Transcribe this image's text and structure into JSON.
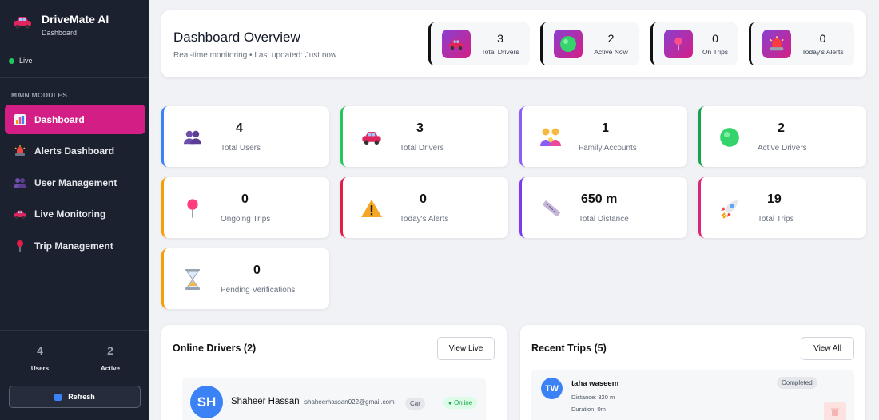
{
  "app": {
    "title": "DriveMate AI",
    "subtitle": "Dashboard",
    "status": "Live"
  },
  "sidebar": {
    "section_label": "MAIN MODULES",
    "items": [
      {
        "label": "Dashboard",
        "icon": "bar-chart-icon",
        "active": true
      },
      {
        "label": "Alerts Dashboard",
        "icon": "siren-icon"
      },
      {
        "label": "User Management",
        "icon": "users-icon"
      },
      {
        "label": "Live Monitoring",
        "icon": "car-icon"
      },
      {
        "label": "Trip Management",
        "icon": "pin-icon"
      }
    ],
    "stats": [
      {
        "value": "4",
        "label": "Users"
      },
      {
        "value": "2",
        "label": "Active"
      }
    ],
    "refresh_label": "Refresh"
  },
  "header": {
    "title": "Dashboard Overview",
    "subtitle": "Real-time monitoring • Last updated: Just now",
    "pills": [
      {
        "value": "3",
        "label": "Total Drivers",
        "icon": "car-icon"
      },
      {
        "value": "2",
        "label": "Active Now",
        "icon": "green-circle-icon"
      },
      {
        "value": "0",
        "label": "On Trips",
        "icon": "pin-icon"
      },
      {
        "value": "0",
        "label": "Today's Alerts",
        "icon": "siren-icon"
      }
    ]
  },
  "cards": [
    {
      "value": "4",
      "label": "Total Users",
      "icon": "users-icon",
      "accent": "#3b82f6"
    },
    {
      "value": "3",
      "label": "Total Drivers",
      "icon": "car-icon",
      "accent": "#22c55e"
    },
    {
      "value": "1",
      "label": "Family Accounts",
      "icon": "family-icon",
      "accent": "#8b5cf6"
    },
    {
      "value": "2",
      "label": "Active Drivers",
      "icon": "green-circle-icon",
      "accent": "#16a34a"
    },
    {
      "value": "0",
      "label": "Ongoing Trips",
      "icon": "pin-icon",
      "accent": "#f59e0b"
    },
    {
      "value": "0",
      "label": "Today's Alerts",
      "icon": "warning-icon",
      "accent": "#e11d48"
    },
    {
      "value": "650 m",
      "label": "Total Distance",
      "icon": "ruler-icon",
      "accent": "#7c3aed"
    },
    {
      "value": "19",
      "label": "Total Trips",
      "icon": "rocket-icon",
      "accent": "#db2777"
    },
    {
      "value": "0",
      "label": "Pending Verifications",
      "icon": "hourglass-icon",
      "accent": "#f59e0b"
    }
  ],
  "online_drivers": {
    "title": "Online Drivers (2)",
    "button": "View Live",
    "first": {
      "initials": "SH",
      "name": "Shaheer Hassan",
      "email": "shaheerhassan022@gmail.com",
      "vehicle": "Car",
      "status": "● Online"
    }
  },
  "recent_trips": {
    "title": "Recent Trips (5)",
    "button": "View All",
    "first": {
      "initials": "TW",
      "name": "taha waseem",
      "status": "Completed",
      "distance": "Distance: 320 m",
      "duration": "Duration: 0m"
    }
  }
}
